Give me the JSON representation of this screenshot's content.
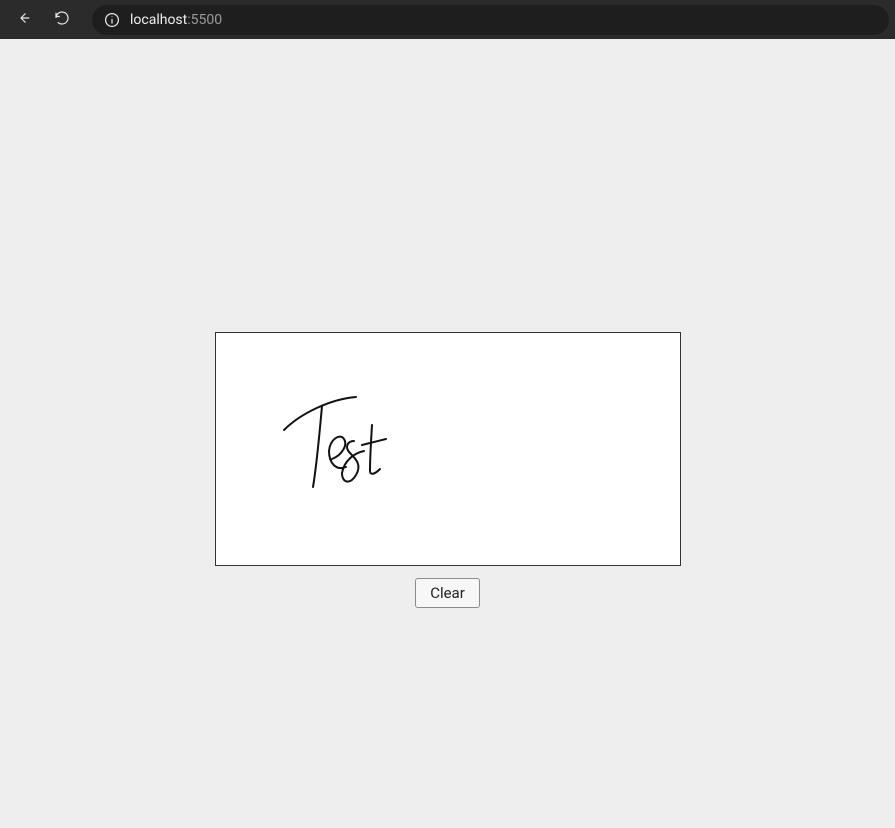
{
  "browser": {
    "url_host": "localhost",
    "url_port": ":5500"
  },
  "canvas": {
    "handwritten_text": "Test"
  },
  "buttons": {
    "clear_label": "Clear"
  }
}
